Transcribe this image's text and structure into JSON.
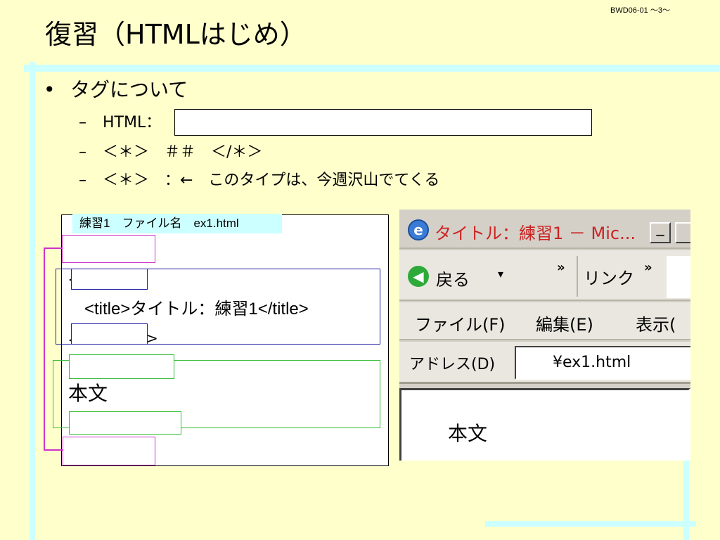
{
  "slide_number": "BWD06-01 ～3～",
  "title": "復習（HTMLはじめ）",
  "bullets": {
    "main": "タグについて",
    "sub1_label": "HTML：",
    "sub2": "＜＊＞　＃＃　＜/＊＞",
    "sub3": "＜＊＞　：←　このタイプは、今週沢山でてくる"
  },
  "code_example": {
    "label": "練習1　ファイル名　ex1.html",
    "title_line": "<title>タイトル：練習1</title>",
    "head_close_tail": ">",
    "body_text": "本文"
  },
  "browser": {
    "window_title": "タイトル：練習1 － Mic...",
    "min_button": "_",
    "back_label": "戻る",
    "back_dropdown": "▾",
    "chevron": "»",
    "links_label": "リンク",
    "menu": [
      "ファイル(F)",
      "編集(E)",
      "表示("
    ],
    "address_label": "アドレス(D)",
    "address_value": "¥ex1.html",
    "content": "本文"
  },
  "colors": {
    "background": "#ffffcc",
    "accent_bar": "#ccffff",
    "html_box": "#cc33cc",
    "head_box": "#1a1aa0",
    "body_box": "#33bb33",
    "browser_title": "#cc2222"
  }
}
